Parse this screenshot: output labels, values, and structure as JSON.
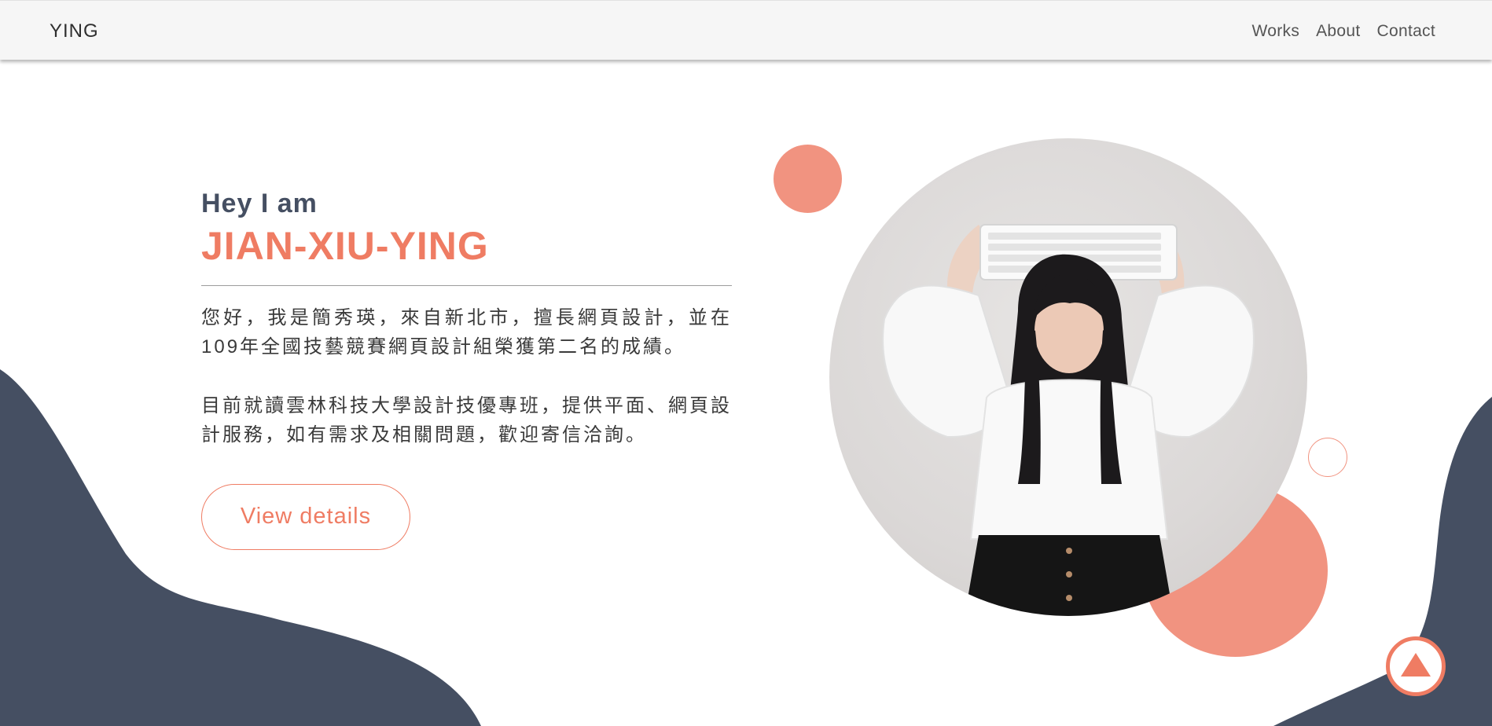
{
  "nav": {
    "brand": "YING",
    "links": [
      "Works",
      "About",
      "Contact"
    ]
  },
  "hero": {
    "greeting": "Hey I am",
    "name": "JIAN-XIU-YING",
    "paragraph1": "您好，我是簡秀瑛，來自新北市，擅長網頁設計，並在109年全國技藝競賽網頁設計組榮獲第二名的成績。",
    "paragraph2": "目前就讀雲林科技大學設計技優專班，提供平面、網頁設計服務，如有需求及相關問題，歡迎寄信洽詢。",
    "cta_label": "View details"
  },
  "colors": {
    "accent": "#ef7c63",
    "accent_soft": "#f19380",
    "navy": "#454f62",
    "navbar_bg": "#f6f6f6"
  },
  "icons": {
    "back_to_top": "triangle-up-icon"
  }
}
